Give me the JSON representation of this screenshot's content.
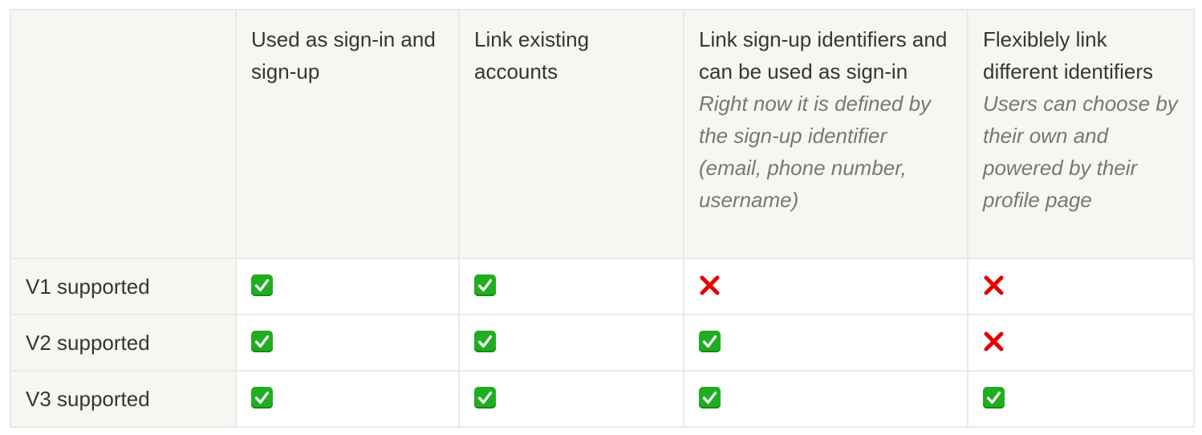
{
  "table": {
    "columns": [
      {
        "title": "",
        "note": ""
      },
      {
        "title": "Used as sign-in and sign-up",
        "note": ""
      },
      {
        "title": "Link existing accounts",
        "note": ""
      },
      {
        "title": "Link sign-up identifiers and can be used as sign-in",
        "note": "Right now it is defined by the sign-up identifier (email, phone number, username)"
      },
      {
        "title": "Flexiblely link different identifiers",
        "note": "Users can choose by their own and powered by their profile page"
      }
    ],
    "rows": [
      {
        "label": "V1 supported",
        "values": [
          "check",
          "check",
          "cross",
          "cross"
        ]
      },
      {
        "label": "V2 supported",
        "values": [
          "check",
          "check",
          "check",
          "cross"
        ]
      },
      {
        "label": "V3 supported",
        "values": [
          "check",
          "check",
          "check",
          "check"
        ]
      }
    ],
    "icons": {
      "check": "white-heavy-check-mark-icon",
      "cross": "cross-mark-icon"
    },
    "colors": {
      "check": "#1fae1f",
      "cross": "#e60000",
      "header_bg": "#f7f6f3",
      "border": "#e9e9e7"
    }
  }
}
